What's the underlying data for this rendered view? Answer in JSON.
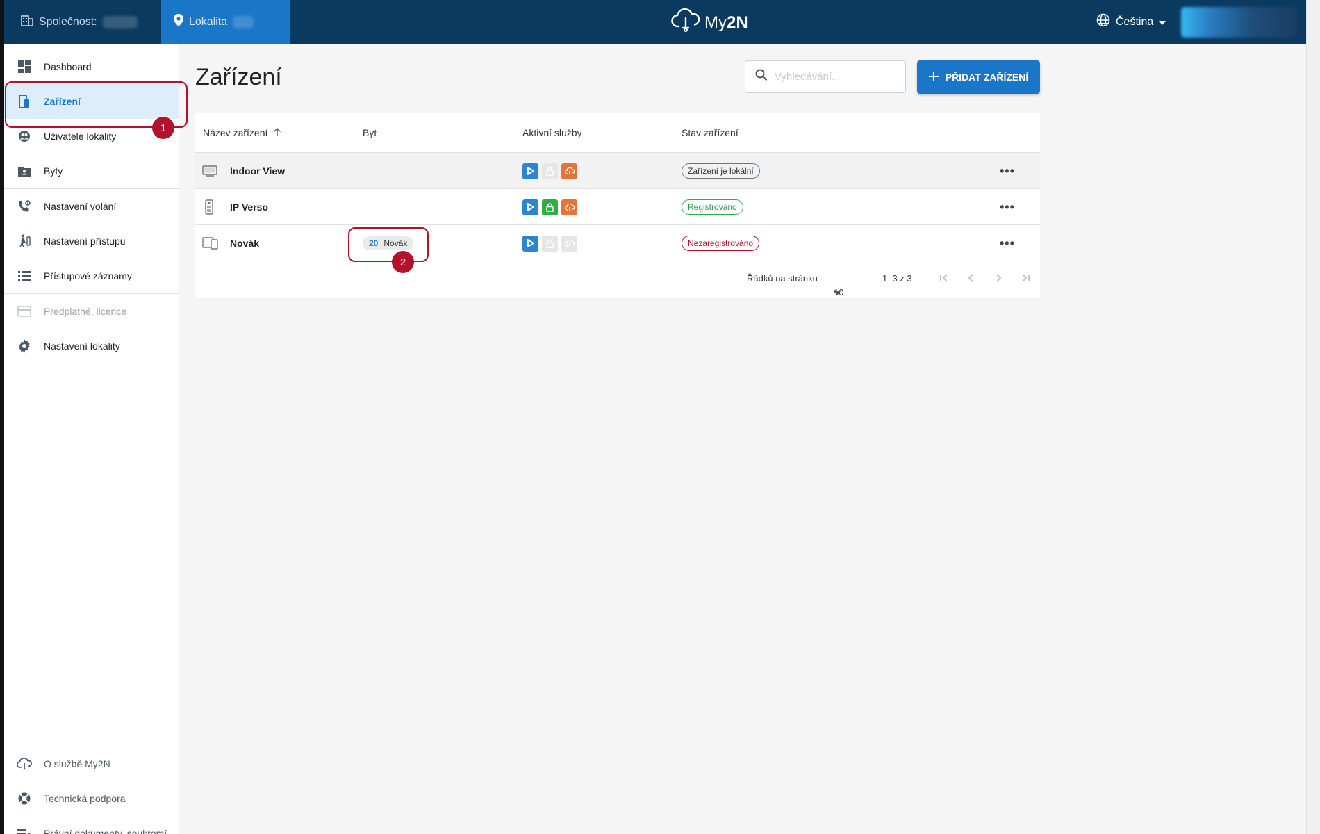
{
  "topbar": {
    "company_label": "Společnost:",
    "location_label": "Lokalita",
    "logo_text_light": "My",
    "logo_text_bold": "2N",
    "language": "Čeština",
    "colors": {
      "bar": "#0b3a60",
      "accent": "#1a76c8"
    }
  },
  "sidebar": {
    "items": [
      {
        "label": "Dashboard",
        "icon": "dashboard-icon"
      },
      {
        "label": "Zařízení",
        "icon": "device-icon",
        "active": true
      },
      {
        "label": "Uživatelé lokality",
        "icon": "users-icon"
      },
      {
        "label": "Byty",
        "icon": "apartments-icon"
      },
      {
        "label": "Nastavení volání",
        "icon": "call-settings-icon"
      },
      {
        "label": "Nastavení přístupu",
        "icon": "access-settings-icon"
      },
      {
        "label": "Přístupové záznamy",
        "icon": "access-log-icon"
      },
      {
        "label": "Předplatné, licence",
        "icon": "subscription-icon",
        "disabled": true
      },
      {
        "label": "Nastavení lokality",
        "icon": "gear-icon"
      }
    ],
    "bottom_items": [
      {
        "label": "O službě My2N",
        "icon": "cloud-icon"
      },
      {
        "label": "Technická podpora",
        "icon": "lifebuoy-icon"
      },
      {
        "label": "Právní dokumenty, soukromí",
        "icon": "legal-docs-icon"
      }
    ]
  },
  "callouts": [
    "1",
    "2"
  ],
  "main": {
    "title": "Zařízení",
    "search_placeholder": "Vyhledávání...",
    "add_button": "PŘIDAT ZAŘÍZENÍ"
  },
  "table": {
    "columns": [
      "Název zařízení",
      "Byt",
      "Aktivní služby",
      "Stav zařízení"
    ],
    "rows": [
      {
        "name": "Indoor View",
        "flat": "—",
        "status": "Zařízení je lokální",
        "status_type": "local",
        "services": [
          "blue",
          "off",
          "orange"
        ]
      },
      {
        "name": "IP Verso",
        "flat": "—",
        "status": "Registrováno",
        "status_type": "ok",
        "services": [
          "blue",
          "green",
          "orange"
        ]
      },
      {
        "name": "Novák",
        "flat_number": "20",
        "flat_name": "Novák",
        "status": "Nezaregistrováno",
        "status_type": "bad",
        "services": [
          "blue",
          "off",
          "off"
        ]
      }
    ],
    "more_label": "•••",
    "pager": {
      "rows_per_page_label": "Řádků na stránku",
      "rows_per_page": "10",
      "range": "1–3 z 3"
    }
  }
}
